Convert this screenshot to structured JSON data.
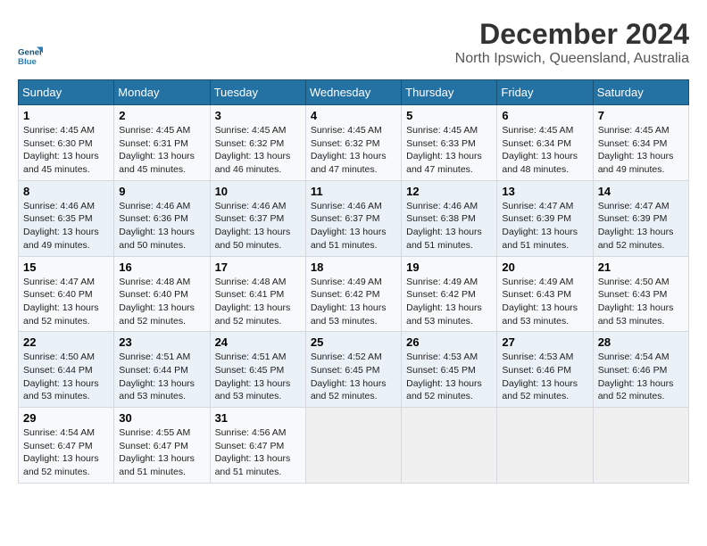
{
  "logo": {
    "line1": "General",
    "line2": "Blue"
  },
  "title": "December 2024",
  "location": "North Ipswich, Queensland, Australia",
  "days_header": [
    "Sunday",
    "Monday",
    "Tuesday",
    "Wednesday",
    "Thursday",
    "Friday",
    "Saturday"
  ],
  "weeks": [
    [
      {
        "day": "1",
        "sunrise": "4:45 AM",
        "sunset": "6:30 PM",
        "daylight": "13 hours and 45 minutes."
      },
      {
        "day": "2",
        "sunrise": "4:45 AM",
        "sunset": "6:31 PM",
        "daylight": "13 hours and 45 minutes."
      },
      {
        "day": "3",
        "sunrise": "4:45 AM",
        "sunset": "6:32 PM",
        "daylight": "13 hours and 46 minutes."
      },
      {
        "day": "4",
        "sunrise": "4:45 AM",
        "sunset": "6:32 PM",
        "daylight": "13 hours and 47 minutes."
      },
      {
        "day": "5",
        "sunrise": "4:45 AM",
        "sunset": "6:33 PM",
        "daylight": "13 hours and 47 minutes."
      },
      {
        "day": "6",
        "sunrise": "4:45 AM",
        "sunset": "6:34 PM",
        "daylight": "13 hours and 48 minutes."
      },
      {
        "day": "7",
        "sunrise": "4:45 AM",
        "sunset": "6:34 PM",
        "daylight": "13 hours and 49 minutes."
      }
    ],
    [
      {
        "day": "8",
        "sunrise": "4:46 AM",
        "sunset": "6:35 PM",
        "daylight": "13 hours and 49 minutes."
      },
      {
        "day": "9",
        "sunrise": "4:46 AM",
        "sunset": "6:36 PM",
        "daylight": "13 hours and 50 minutes."
      },
      {
        "day": "10",
        "sunrise": "4:46 AM",
        "sunset": "6:37 PM",
        "daylight": "13 hours and 50 minutes."
      },
      {
        "day": "11",
        "sunrise": "4:46 AM",
        "sunset": "6:37 PM",
        "daylight": "13 hours and 51 minutes."
      },
      {
        "day": "12",
        "sunrise": "4:46 AM",
        "sunset": "6:38 PM",
        "daylight": "13 hours and 51 minutes."
      },
      {
        "day": "13",
        "sunrise": "4:47 AM",
        "sunset": "6:39 PM",
        "daylight": "13 hours and 51 minutes."
      },
      {
        "day": "14",
        "sunrise": "4:47 AM",
        "sunset": "6:39 PM",
        "daylight": "13 hours and 52 minutes."
      }
    ],
    [
      {
        "day": "15",
        "sunrise": "4:47 AM",
        "sunset": "6:40 PM",
        "daylight": "13 hours and 52 minutes."
      },
      {
        "day": "16",
        "sunrise": "4:48 AM",
        "sunset": "6:40 PM",
        "daylight": "13 hours and 52 minutes."
      },
      {
        "day": "17",
        "sunrise": "4:48 AM",
        "sunset": "6:41 PM",
        "daylight": "13 hours and 52 minutes."
      },
      {
        "day": "18",
        "sunrise": "4:49 AM",
        "sunset": "6:42 PM",
        "daylight": "13 hours and 53 minutes."
      },
      {
        "day": "19",
        "sunrise": "4:49 AM",
        "sunset": "6:42 PM",
        "daylight": "13 hours and 53 minutes."
      },
      {
        "day": "20",
        "sunrise": "4:49 AM",
        "sunset": "6:43 PM",
        "daylight": "13 hours and 53 minutes."
      },
      {
        "day": "21",
        "sunrise": "4:50 AM",
        "sunset": "6:43 PM",
        "daylight": "13 hours and 53 minutes."
      }
    ],
    [
      {
        "day": "22",
        "sunrise": "4:50 AM",
        "sunset": "6:44 PM",
        "daylight": "13 hours and 53 minutes."
      },
      {
        "day": "23",
        "sunrise": "4:51 AM",
        "sunset": "6:44 PM",
        "daylight": "13 hours and 53 minutes."
      },
      {
        "day": "24",
        "sunrise": "4:51 AM",
        "sunset": "6:45 PM",
        "daylight": "13 hours and 53 minutes."
      },
      {
        "day": "25",
        "sunrise": "4:52 AM",
        "sunset": "6:45 PM",
        "daylight": "13 hours and 52 minutes."
      },
      {
        "day": "26",
        "sunrise": "4:53 AM",
        "sunset": "6:45 PM",
        "daylight": "13 hours and 52 minutes."
      },
      {
        "day": "27",
        "sunrise": "4:53 AM",
        "sunset": "6:46 PM",
        "daylight": "13 hours and 52 minutes."
      },
      {
        "day": "28",
        "sunrise": "4:54 AM",
        "sunset": "6:46 PM",
        "daylight": "13 hours and 52 minutes."
      }
    ],
    [
      {
        "day": "29",
        "sunrise": "4:54 AM",
        "sunset": "6:47 PM",
        "daylight": "13 hours and 52 minutes."
      },
      {
        "day": "30",
        "sunrise": "4:55 AM",
        "sunset": "6:47 PM",
        "daylight": "13 hours and 51 minutes."
      },
      {
        "day": "31",
        "sunrise": "4:56 AM",
        "sunset": "6:47 PM",
        "daylight": "13 hours and 51 minutes."
      },
      null,
      null,
      null,
      null
    ]
  ],
  "labels": {
    "sunrise_prefix": "Sunrise: ",
    "sunset_prefix": "Sunset: ",
    "daylight_prefix": "Daylight: "
  }
}
